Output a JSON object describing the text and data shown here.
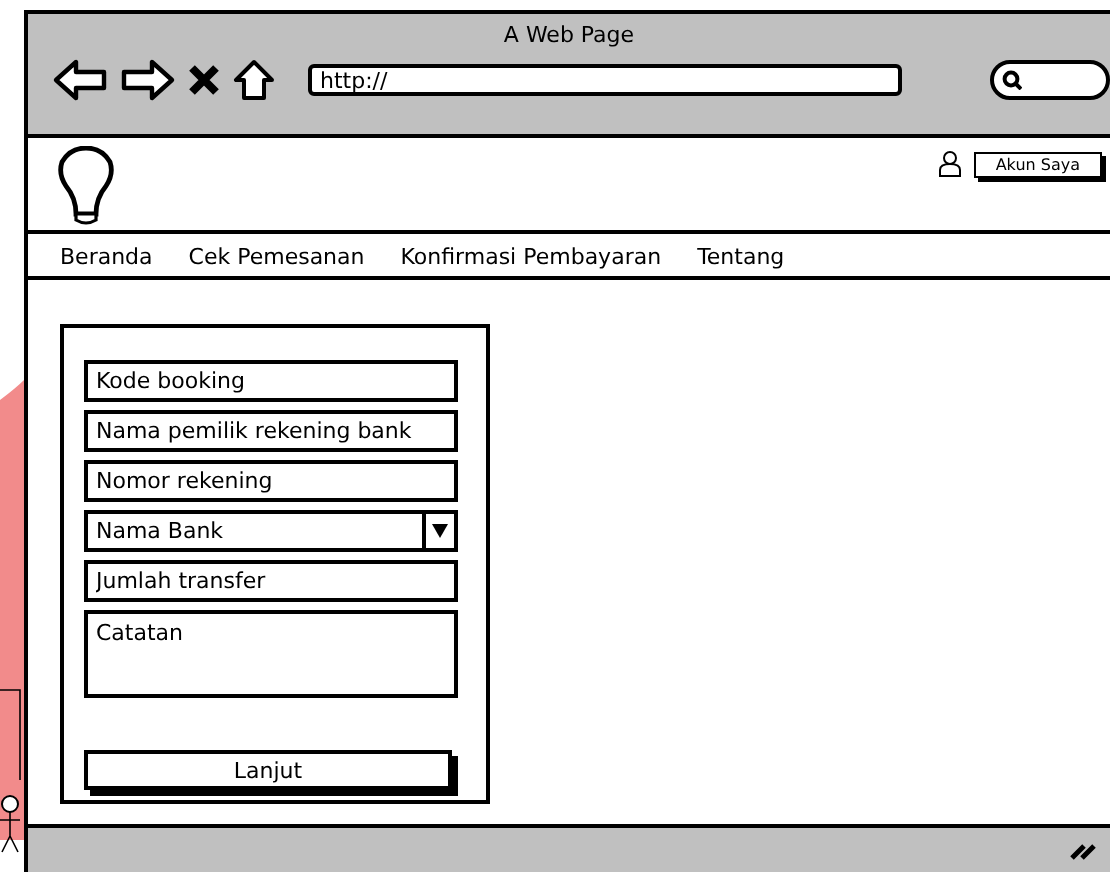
{
  "window": {
    "title": "A Web Page"
  },
  "address_bar": {
    "value": "http://"
  },
  "header": {
    "account_button": "Akun Saya"
  },
  "nav": {
    "items": [
      "Beranda",
      "Cek Pemesanan",
      "Konfirmasi Pembayaran",
      "Tentang"
    ]
  },
  "form": {
    "fields": [
      {
        "kind": "text",
        "placeholder": "Kode booking"
      },
      {
        "kind": "text",
        "placeholder": "Nama pemilik rekening bank"
      },
      {
        "kind": "text",
        "placeholder": "Nomor rekening"
      },
      {
        "kind": "select",
        "value": "Nama Bank"
      },
      {
        "kind": "text",
        "placeholder": "Jumlah transfer"
      },
      {
        "kind": "textarea",
        "placeholder": "Catatan"
      }
    ],
    "submit": "Lanjut"
  }
}
